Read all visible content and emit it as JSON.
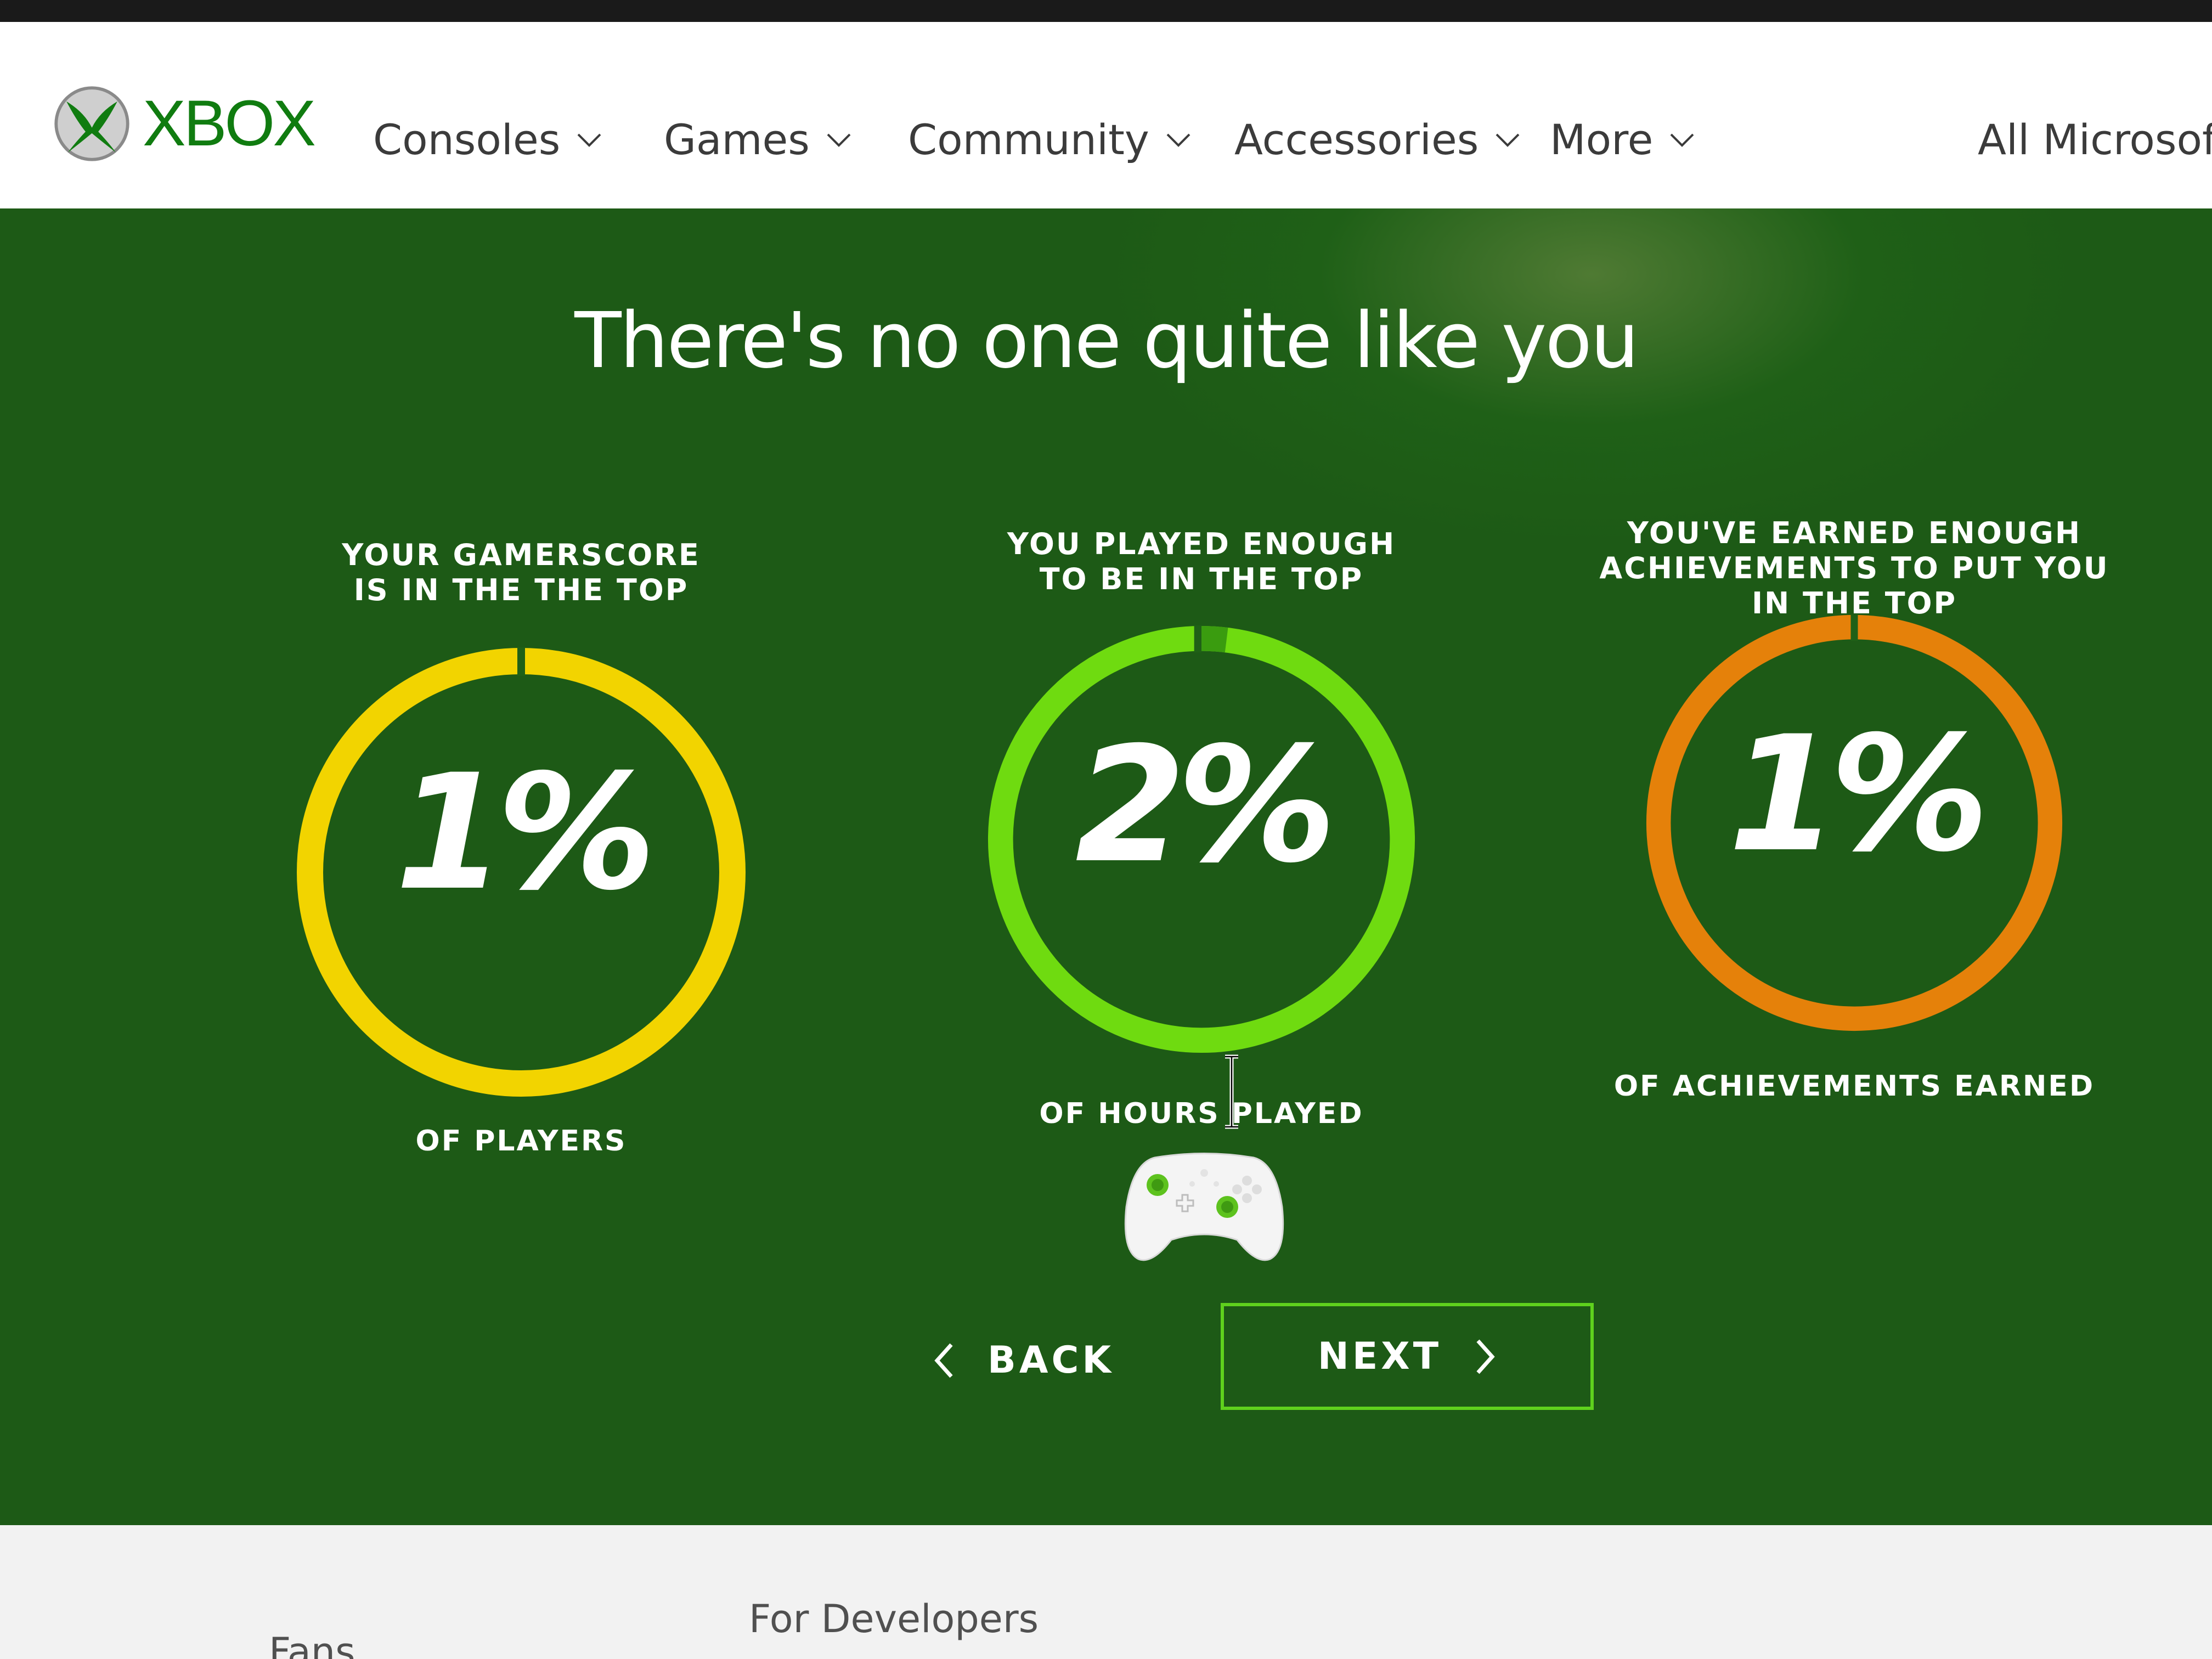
{
  "brand": {
    "logo_text": "XBOX",
    "accent": "#107c10"
  },
  "nav": {
    "items": [
      {
        "label": "Consoles"
      },
      {
        "label": "Games"
      },
      {
        "label": "Community"
      },
      {
        "label": "Accessories"
      },
      {
        "label": "More"
      }
    ],
    "all_microsoft": "All Microsoft"
  },
  "hero": {
    "title": "There's no one quite like you",
    "stats": [
      {
        "top": "YOUR GAMERSCORE\nIS IN THE THE TOP",
        "value": "1%",
        "bottom": "OF PLAYERS",
        "color": "#f2d400",
        "percent": 1
      },
      {
        "top": "YOU PLAYED ENOUGH\nTO BE IN THE TOP",
        "value": "2%",
        "bottom": "OF HOURS PLAYED",
        "color": "#6fdb10",
        "percent": 2
      },
      {
        "top": "YOU'VE EARNED ENOUGH\nACHIEVEMENTS TO PUT YOU IN THE TOP",
        "value": "1%",
        "bottom": "OF ACHIEVEMENTS EARNED",
        "color": "#e5810a",
        "percent": 1
      }
    ],
    "back_label": "BACK",
    "next_label": "NEXT"
  },
  "footer": {
    "links": [
      "Fans",
      "For Developers"
    ]
  }
}
